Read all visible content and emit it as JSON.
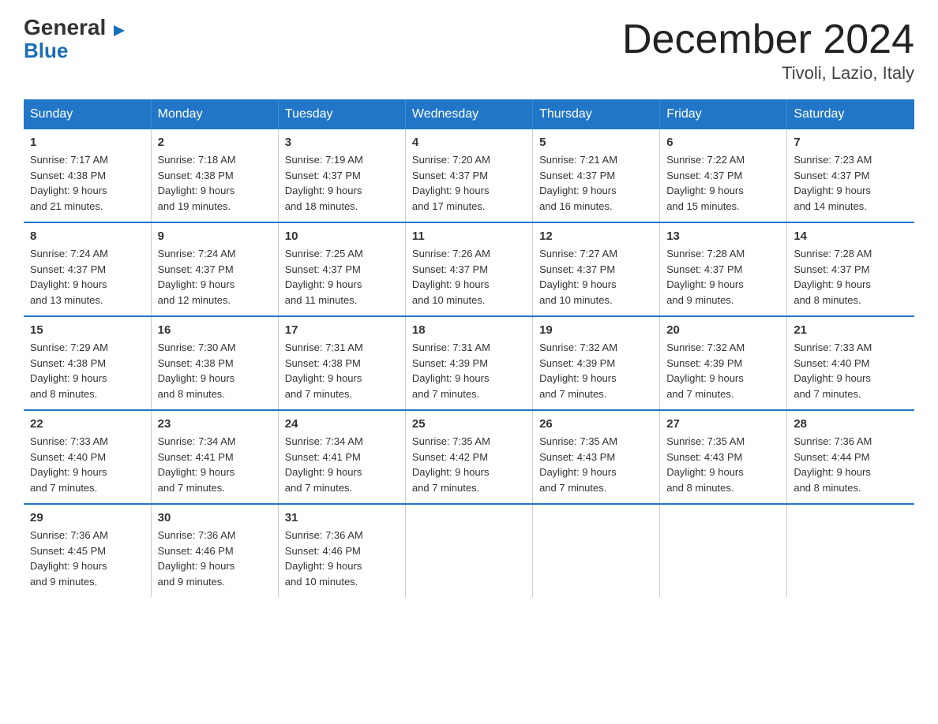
{
  "logo": {
    "general": "General",
    "triangle": "▶",
    "blue": "Blue"
  },
  "header": {
    "title": "December 2024",
    "location": "Tivoli, Lazio, Italy"
  },
  "weekdays": [
    "Sunday",
    "Monday",
    "Tuesday",
    "Wednesday",
    "Thursday",
    "Friday",
    "Saturday"
  ],
  "weeks": [
    [
      {
        "day": "1",
        "sunrise": "7:17 AM",
        "sunset": "4:38 PM",
        "daylight": "9 hours and 21 minutes."
      },
      {
        "day": "2",
        "sunrise": "7:18 AM",
        "sunset": "4:38 PM",
        "daylight": "9 hours and 19 minutes."
      },
      {
        "day": "3",
        "sunrise": "7:19 AM",
        "sunset": "4:37 PM",
        "daylight": "9 hours and 18 minutes."
      },
      {
        "day": "4",
        "sunrise": "7:20 AM",
        "sunset": "4:37 PM",
        "daylight": "9 hours and 17 minutes."
      },
      {
        "day": "5",
        "sunrise": "7:21 AM",
        "sunset": "4:37 PM",
        "daylight": "9 hours and 16 minutes."
      },
      {
        "day": "6",
        "sunrise": "7:22 AM",
        "sunset": "4:37 PM",
        "daylight": "9 hours and 15 minutes."
      },
      {
        "day": "7",
        "sunrise": "7:23 AM",
        "sunset": "4:37 PM",
        "daylight": "9 hours and 14 minutes."
      }
    ],
    [
      {
        "day": "8",
        "sunrise": "7:24 AM",
        "sunset": "4:37 PM",
        "daylight": "9 hours and 13 minutes."
      },
      {
        "day": "9",
        "sunrise": "7:24 AM",
        "sunset": "4:37 PM",
        "daylight": "9 hours and 12 minutes."
      },
      {
        "day": "10",
        "sunrise": "7:25 AM",
        "sunset": "4:37 PM",
        "daylight": "9 hours and 11 minutes."
      },
      {
        "day": "11",
        "sunrise": "7:26 AM",
        "sunset": "4:37 PM",
        "daylight": "9 hours and 10 minutes."
      },
      {
        "day": "12",
        "sunrise": "7:27 AM",
        "sunset": "4:37 PM",
        "daylight": "9 hours and 10 minutes."
      },
      {
        "day": "13",
        "sunrise": "7:28 AM",
        "sunset": "4:37 PM",
        "daylight": "9 hours and 9 minutes."
      },
      {
        "day": "14",
        "sunrise": "7:28 AM",
        "sunset": "4:37 PM",
        "daylight": "9 hours and 8 minutes."
      }
    ],
    [
      {
        "day": "15",
        "sunrise": "7:29 AM",
        "sunset": "4:38 PM",
        "daylight": "9 hours and 8 minutes."
      },
      {
        "day": "16",
        "sunrise": "7:30 AM",
        "sunset": "4:38 PM",
        "daylight": "9 hours and 8 minutes."
      },
      {
        "day": "17",
        "sunrise": "7:31 AM",
        "sunset": "4:38 PM",
        "daylight": "9 hours and 7 minutes."
      },
      {
        "day": "18",
        "sunrise": "7:31 AM",
        "sunset": "4:39 PM",
        "daylight": "9 hours and 7 minutes."
      },
      {
        "day": "19",
        "sunrise": "7:32 AM",
        "sunset": "4:39 PM",
        "daylight": "9 hours and 7 minutes."
      },
      {
        "day": "20",
        "sunrise": "7:32 AM",
        "sunset": "4:39 PM",
        "daylight": "9 hours and 7 minutes."
      },
      {
        "day": "21",
        "sunrise": "7:33 AM",
        "sunset": "4:40 PM",
        "daylight": "9 hours and 7 minutes."
      }
    ],
    [
      {
        "day": "22",
        "sunrise": "7:33 AM",
        "sunset": "4:40 PM",
        "daylight": "9 hours and 7 minutes."
      },
      {
        "day": "23",
        "sunrise": "7:34 AM",
        "sunset": "4:41 PM",
        "daylight": "9 hours and 7 minutes."
      },
      {
        "day": "24",
        "sunrise": "7:34 AM",
        "sunset": "4:41 PM",
        "daylight": "9 hours and 7 minutes."
      },
      {
        "day": "25",
        "sunrise": "7:35 AM",
        "sunset": "4:42 PM",
        "daylight": "9 hours and 7 minutes."
      },
      {
        "day": "26",
        "sunrise": "7:35 AM",
        "sunset": "4:43 PM",
        "daylight": "9 hours and 7 minutes."
      },
      {
        "day": "27",
        "sunrise": "7:35 AM",
        "sunset": "4:43 PM",
        "daylight": "9 hours and 8 minutes."
      },
      {
        "day": "28",
        "sunrise": "7:36 AM",
        "sunset": "4:44 PM",
        "daylight": "9 hours and 8 minutes."
      }
    ],
    [
      {
        "day": "29",
        "sunrise": "7:36 AM",
        "sunset": "4:45 PM",
        "daylight": "9 hours and 9 minutes."
      },
      {
        "day": "30",
        "sunrise": "7:36 AM",
        "sunset": "4:46 PM",
        "daylight": "9 hours and 9 minutes."
      },
      {
        "day": "31",
        "sunrise": "7:36 AM",
        "sunset": "4:46 PM",
        "daylight": "9 hours and 10 minutes."
      },
      null,
      null,
      null,
      null
    ]
  ],
  "labels": {
    "sunrise": "Sunrise:",
    "sunset": "Sunset:",
    "daylight": "Daylight:"
  }
}
